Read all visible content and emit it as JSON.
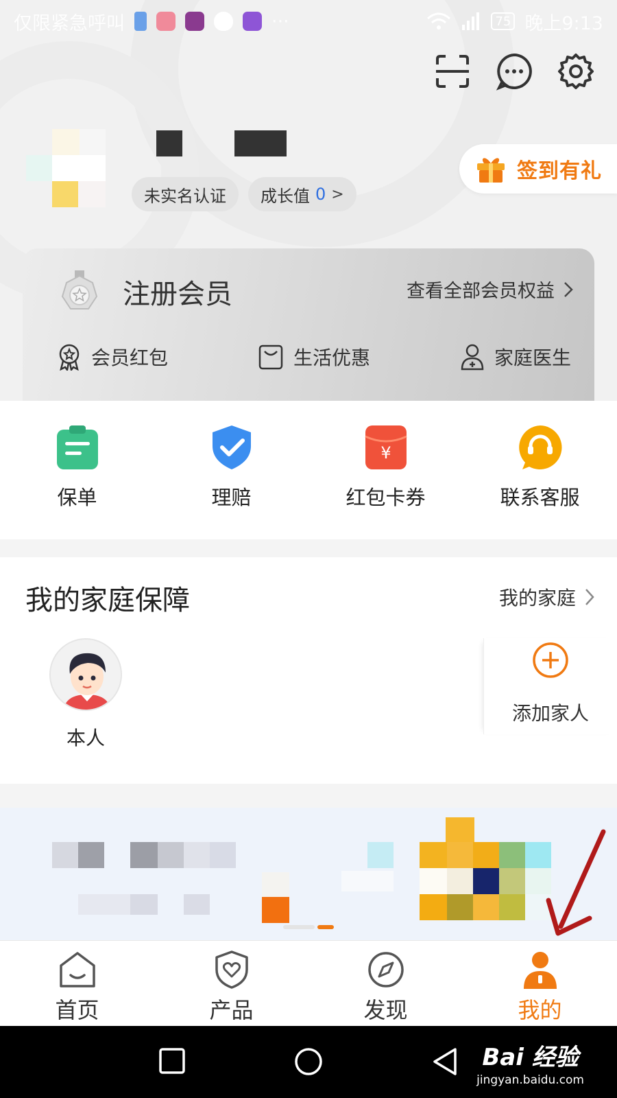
{
  "status_bar": {
    "left_text": "仅限紧急呼叫",
    "more": "···",
    "battery": "75",
    "time": "晚上9:13"
  },
  "top_actions": [
    {
      "name": "scan-icon"
    },
    {
      "name": "message-icon"
    },
    {
      "name": "settings-icon"
    }
  ],
  "profile": {
    "tags": {
      "realname": "未实名认证",
      "growth_label": "成长值",
      "growth_value": "0",
      "growth_chevron": ">"
    },
    "checkin_label": "签到有礼"
  },
  "member": {
    "title": "注册会员",
    "link": "查看全部会员权益",
    "perks": [
      {
        "label": "会员红包",
        "icon": "badge-icon"
      },
      {
        "label": "生活优惠",
        "icon": "bag-icon"
      },
      {
        "label": "家庭医生",
        "icon": "doctor-icon"
      }
    ]
  },
  "quick_actions": [
    {
      "label": "保单",
      "icon": "policy-icon",
      "color": "#3cc18a"
    },
    {
      "label": "理赔",
      "icon": "claim-shield-icon",
      "color": "#3b8ef0"
    },
    {
      "label": "红包卡券",
      "icon": "red-envelope-icon",
      "color": "#f0523a"
    },
    {
      "label": "联系客服",
      "icon": "customer-service-icon",
      "color": "#f7a800"
    }
  ],
  "family": {
    "title": "我的家庭保障",
    "link": "我的家庭",
    "self_label": "本人",
    "add_label": "添加家人"
  },
  "tabs": [
    {
      "label": "首页",
      "icon": "home-icon",
      "active": false
    },
    {
      "label": "产品",
      "icon": "product-shield-icon",
      "active": false
    },
    {
      "label": "发现",
      "icon": "compass-icon",
      "active": false
    },
    {
      "label": "我的",
      "icon": "person-icon",
      "active": true
    }
  ],
  "colors": {
    "accent": "#f07a12",
    "link_blue": "#2f6fe0"
  },
  "watermark": {
    "brand": "Bai 经验",
    "url": "jingyan.baidu.com"
  }
}
